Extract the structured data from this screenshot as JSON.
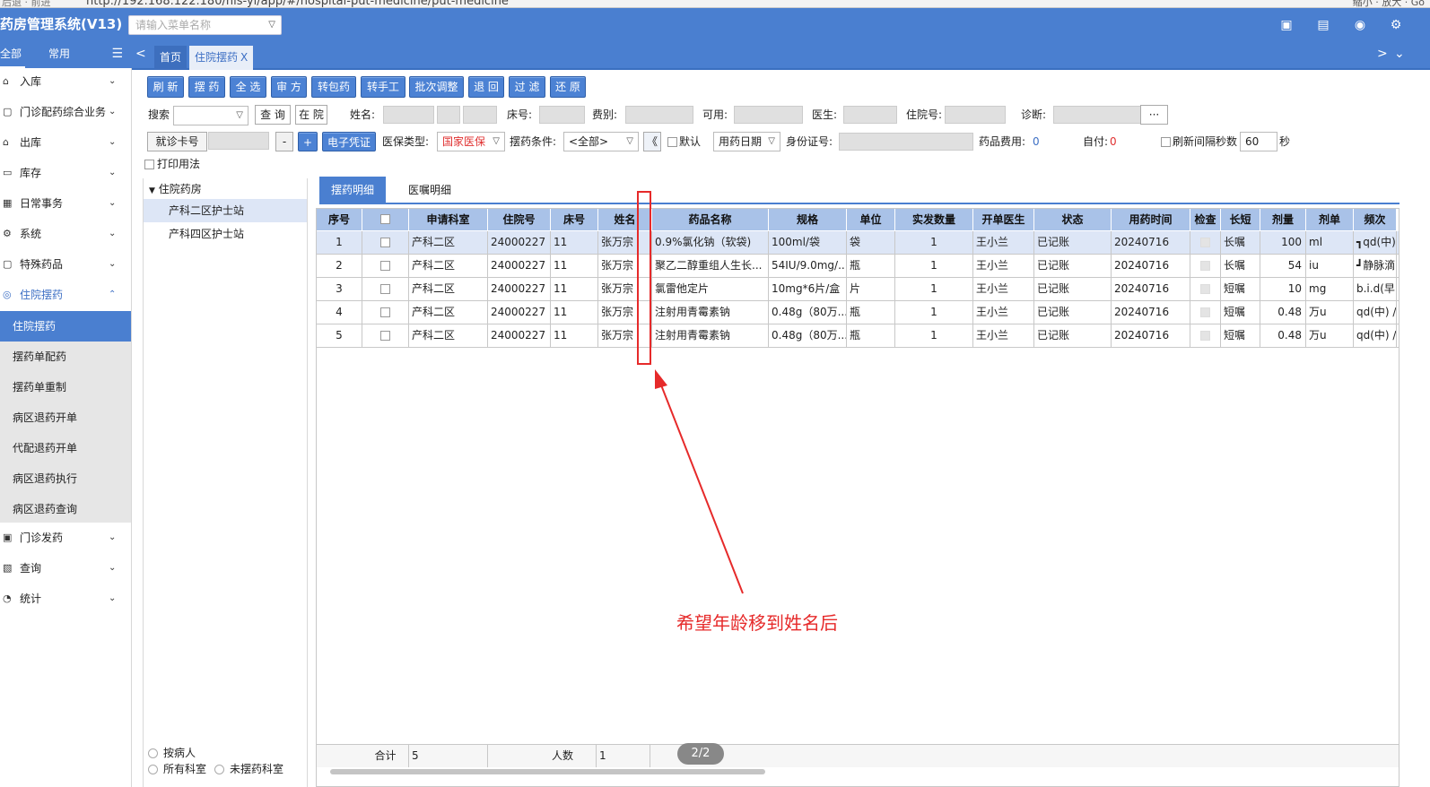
{
  "browser": {
    "nav_text": "后退 · 前进",
    "url": "http://192.168.122.180/his-yl/app/#/hospital-put-medicine/put-medicine",
    "right_text": "缩小 · 放大 · Go"
  },
  "header": {
    "title": "药房管理系统(V13)",
    "menu_search_placeholder": "请输入菜单名称"
  },
  "sidebar": {
    "tab_all": "全部",
    "tab_common": "常用",
    "menu": [
      {
        "label": "入库"
      },
      {
        "label": "门诊配药综合业务"
      },
      {
        "label": "出库"
      },
      {
        "label": "库存"
      },
      {
        "label": "日常事务"
      },
      {
        "label": "系统"
      },
      {
        "label": "特殊药品"
      },
      {
        "label": "住院摆药"
      }
    ],
    "sub": [
      {
        "label": "住院摆药"
      },
      {
        "label": "摆药单配药"
      },
      {
        "label": "摆药单重制"
      },
      {
        "label": "病区退药开单"
      },
      {
        "label": "代配退药开单"
      },
      {
        "label": "病区退药执行"
      },
      {
        "label": "病区退药查询"
      }
    ],
    "menu_bottom": [
      {
        "label": "门诊发药"
      },
      {
        "label": "查询"
      },
      {
        "label": "统计"
      }
    ]
  },
  "tabs": [
    {
      "label": "首页"
    },
    {
      "label": "住院摆药",
      "close": "X"
    }
  ],
  "toolbar": [
    "刷 新",
    "摆 药",
    "全 选",
    "审 方",
    "转包药",
    "转手工",
    "批次调整",
    "退 回",
    "过 滤",
    "还 原"
  ],
  "filters": {
    "search_label": "搜索",
    "query_btn": "查 询",
    "inhosp_btn": "在 院",
    "name_label": "姓名:",
    "bed_label": "床号:",
    "fee_label": "费别:",
    "avail_label": "可用:",
    "doctor_label": "医生:",
    "hosp_no_label": "住院号:",
    "diag_label": "诊断:",
    "more_btn": "···",
    "card_label": "就诊卡号",
    "minus_btn": "-",
    "plus_btn": "+",
    "evoucher_btn": "电子凭证",
    "ins_type_label": "医保类型:",
    "ins_type_value": "国家医保",
    "cond_label": "摆药条件:",
    "cond_value": "<全部>",
    "collapse_btn": "《",
    "default_label": "默认",
    "date_value": "用药日期",
    "id_label": "身份证号:",
    "drugfee_label": "药品费用:",
    "drugfee_value": "0",
    "self_label": "自付:",
    "self_value": "0",
    "refresh_label": "刷新间隔秒数",
    "refresh_value": "60",
    "sec_label": "秒",
    "print_label": "打印用法"
  },
  "tree": {
    "root": "住院药房",
    "nodes": [
      "产科二区护士站",
      "产科四区护士站"
    ],
    "radio1": "按病人",
    "radio2": "所有科室",
    "radio3": "未摆药科室"
  },
  "detail_tabs": [
    "摆药明细",
    "医嘱明细"
  ],
  "grid": {
    "headers": [
      "序号",
      "",
      "申请科室",
      "住院号",
      "床号",
      "姓名",
      "药品名称",
      "规格",
      "单位",
      "实发数量",
      "开单医生",
      "状态",
      "用药时间",
      "检查",
      "长短",
      "剂量",
      "剂单",
      "频次"
    ],
    "rows": [
      [
        "1",
        "",
        "产科二区",
        "24000227",
        "11",
        "张万宗",
        "0.9%氯化钠（软袋)",
        "100ml/袋",
        "袋",
        "1",
        "王小兰",
        "已记账",
        "20240716",
        "",
        "长嘱",
        "100",
        "ml",
        "┓qd(中)"
      ],
      [
        "2",
        "",
        "产科二区",
        "24000227",
        "11",
        "张万宗",
        "聚乙二醇重组人生长...",
        "54IU/9.0mg/...",
        "瓶",
        "1",
        "王小兰",
        "已记账",
        "20240716",
        "",
        "长嘱",
        "54",
        "iu",
        "┛静脉滴"
      ],
      [
        "3",
        "",
        "产科二区",
        "24000227",
        "11",
        "张万宗",
        "氯雷他定片",
        "10mg*6片/盒",
        "片",
        "1",
        "王小兰",
        "已记账",
        "20240716",
        "",
        "短嘱",
        "10",
        "mg",
        "b.i.d(早"
      ],
      [
        "4",
        "",
        "产科二区",
        "24000227",
        "11",
        "张万宗",
        "注射用青霉素钠",
        "0.48g（80万...",
        "瓶",
        "1",
        "王小兰",
        "已记账",
        "20240716",
        "",
        "短嘱",
        "0.48",
        "万u",
        "qd(中) /"
      ],
      [
        "5",
        "",
        "产科二区",
        "24000227",
        "11",
        "张万宗",
        "注射用青霉素钠",
        "0.48g（80万...",
        "瓶",
        "1",
        "王小兰",
        "已记账",
        "20240716",
        "",
        "短嘱",
        "0.48",
        "万u",
        "qd(中) /"
      ]
    ],
    "footer": {
      "total_label": "合计",
      "total_value": "5",
      "count_label": "人数",
      "count_value": "1"
    }
  },
  "pager": "2/2",
  "annotation": "希望年龄移到姓名后"
}
